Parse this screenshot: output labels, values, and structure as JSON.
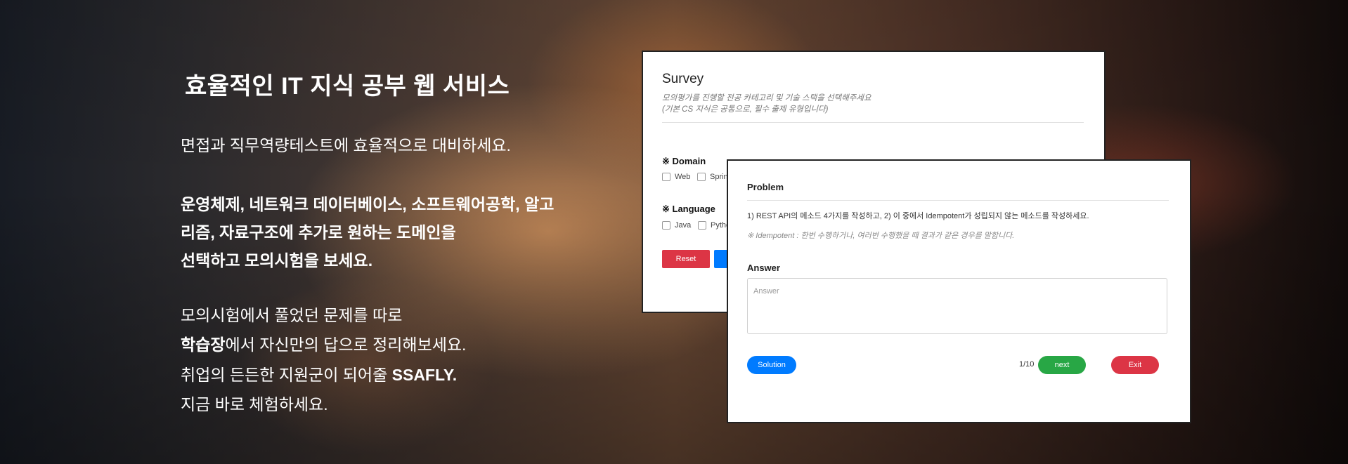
{
  "hero": {
    "headline": "효율적인 IT 지식 공부 웹 서비스",
    "line1": "면접과 직무역량테스트에 효율적으로 대비하세요.",
    "block_lines": [
      "운영체제, 네트워크 데이터베이스, 소프트웨어공학, 알고",
      "리즘, 자료구조에 추가로 원하는 도메인을",
      "선택하고 모의시험을 보세요."
    ],
    "line_practice": "모의시험에서 풀었던 문제를 따로",
    "study_bold": "학습장",
    "study_rest": "에서 자신만의 답으로 정리해보세요.",
    "support_prefix": "취업의 든든한 지원군이 되어줄 ",
    "brand": "SSAFLY.",
    "cta": "지금 바로 체험하세요."
  },
  "survey": {
    "title": "Survey",
    "desc_line1": "모의평가를 진행할 전공 카테고리 및 기술 스택을 선택해주세요",
    "desc_line2": "(기본 CS 지식은 공통으로, 필수 출제 유형입니다)",
    "domain_label": "※ Domain",
    "domain_options": [
      "Web",
      "Spring"
    ],
    "language_label": "※ Language",
    "language_options": [
      "Java",
      "Python"
    ],
    "reset_label": "Reset"
  },
  "problem": {
    "title": "Problem",
    "question": "1) REST API의 메소드 4가지를 작성하고, 2) 이 중에서 Idempotent가 성립되지 않는 메소드를 작성하세요.",
    "note": "※ Idempotent : 한번 수행하거나, 여러번 수행했을 때 결과가 같은 경우를 말합니다.",
    "answer_label": "Answer",
    "answer_placeholder": "Answer",
    "solution_label": "Solution",
    "counter": "1/10",
    "next_label": "next",
    "exit_label": "Exit"
  }
}
